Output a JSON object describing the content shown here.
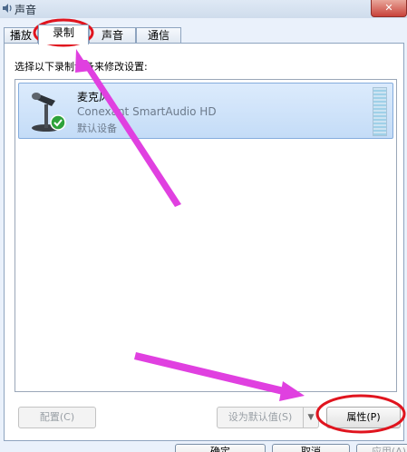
{
  "window": {
    "title": "声音",
    "close_label": "✕"
  },
  "tabs": [
    {
      "label": "播放"
    },
    {
      "label": "录制"
    },
    {
      "label": "声音"
    },
    {
      "label": "通信"
    }
  ],
  "active_tab": "录制",
  "instruction": "选择以下录制设备来修改设置:",
  "devices": [
    {
      "name": "麦克风",
      "driver": "Conexant SmartAudio HD",
      "status": "默认设备",
      "icon": "microphone-icon",
      "status_icon": "check-icon"
    }
  ],
  "buttons": {
    "configure": "配置(C)",
    "set_default": "设为默认值(S)",
    "properties": "属性(P)"
  },
  "dialog_buttons": {
    "ok": "确定",
    "cancel": "取消",
    "apply": "应用(A)"
  },
  "colors": {
    "selection": "#c4dcf7",
    "annotation_circle": "#e0141e",
    "annotation_arrow": "#e040e0"
  }
}
